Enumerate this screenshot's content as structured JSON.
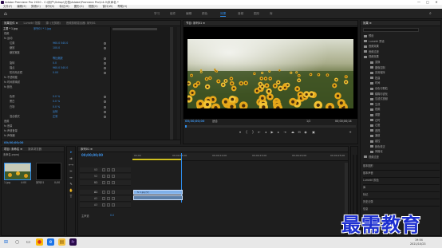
{
  "window": {
    "title": "Adobe Premiere Pro 2020 - C:\\用户\\Gdrop\\文档\\Adobe\\Premiere Pro\\14.0\\未命名 *",
    "minimize": "—",
    "maximize": "□",
    "close": "✕"
  },
  "menu": [
    "文件(F)",
    "编辑(E)",
    "剪辑(C)",
    "序列(S)",
    "标记(M)",
    "图形(G)",
    "视图(V)",
    "窗口(W)",
    "帮助(H)"
  ],
  "workspaces": [
    {
      "label": "学习",
      "active": false
    },
    {
      "label": "组件",
      "active": false
    },
    {
      "label": "编辑",
      "active": false
    },
    {
      "label": "颜色",
      "active": false
    },
    {
      "label": "效果",
      "active": true
    },
    {
      "label": "音频",
      "active": false
    },
    {
      "label": "图形",
      "active": false
    },
    {
      "label": "库",
      "active": false
    }
  ],
  "effect_controls": {
    "tabs": [
      "效果控件 ≡",
      "Lumetri 范围",
      "源: (无剪辑)",
      "音频剪辑混合器: 序列01"
    ],
    "clip_label": "主要 * 1.jpg",
    "sequence_label": "序列01 * 1.jpg",
    "rows": [
      {
        "label": "视频",
        "value": ""
      },
      {
        "label": "fx 运动",
        "value": ""
      },
      {
        "label": "位置",
        "value": "960.0   540.0"
      },
      {
        "label": "缩放",
        "value": "100.0"
      },
      {
        "label": "缩放宽度",
        "value": ""
      },
      {
        "label": "",
        "value": "等比缩放"
      },
      {
        "label": "旋转",
        "value": "0.0"
      },
      {
        "label": "锚点",
        "value": "960.0   540.0"
      },
      {
        "label": "防闪烁滤镜",
        "value": "0.00"
      },
      {
        "label": "fx 不透明度",
        "value": ""
      },
      {
        "label": "fx 时间重映射",
        "value": ""
      },
      {
        "label": "fx 颜色",
        "value": ""
      },
      {
        "label": "",
        "value": ""
      },
      {
        "label": "色调",
        "value": "0.0 %"
      },
      {
        "label": "黑白",
        "value": "0.0 %"
      },
      {
        "label": "白场",
        "value": "0.0 %"
      },
      {
        "label": "",
        "value": "反转"
      },
      {
        "label": "混合模式",
        "value": "正常"
      },
      {
        "label": "音频",
        "value": ""
      },
      {
        "label": "fx 音量",
        "value": ""
      },
      {
        "label": "fx 声道音量",
        "value": ""
      },
      {
        "label": "fx 声像器",
        "value": ""
      }
    ],
    "timecode": "00;00;00;00"
  },
  "program_monitor": {
    "tab": "节目: 序列01 ≡",
    "timecode_left": "00;00;00;00",
    "fit": "适合",
    "quality": "1/2",
    "timecode_right": "00;00;00;14"
  },
  "project": {
    "tabs": [
      "项目: 未命名 ≡",
      "媒体浏览器"
    ],
    "file": "未命名.prproj",
    "items": [
      {
        "name": "1.jpg",
        "info": "4:00"
      },
      {
        "name": "序列01",
        "info": "0;00"
      }
    ]
  },
  "timeline": {
    "tab": "序列01 ≡",
    "timecode": "00;00;00;00",
    "ruler": [
      "00;00",
      "00;00;05;00",
      "00;00;10;00",
      "00;00;15;00",
      "00;00;20;00",
      "00;00;25;00"
    ],
    "tracks": [
      "V3",
      "V2",
      "V1",
      "A1",
      "A2",
      "A3"
    ],
    "master": "主声道",
    "master_value": "0.0",
    "clip_label": "fx 1.jpg [V]"
  },
  "effects": {
    "tab": "效果 ≡",
    "items": [
      "预设",
      "Lumetri 预设",
      "音频效果",
      "音频过渡",
      "视频效果",
      "变换",
      "图像控制",
      "实用程序",
      "扭曲",
      "时间",
      "杂色与颗粒",
      "模糊与锐化",
      "沉浸式视频",
      "生成",
      "视频",
      "调整",
      "过时",
      "过渡",
      "透视",
      "通道",
      "键控",
      "颜色校正",
      "风格化",
      "视频过渡"
    ],
    "selected": "颜色",
    "bottom": [
      "基本图形",
      "基本声音",
      "Lumetri 颜色",
      "库",
      "标记",
      "历史记录",
      "信息"
    ]
  },
  "taskbar": {
    "time": "19:54",
    "date": "2021/10/23"
  },
  "watermark": "最需教育",
  "colors": {
    "accent": "#2d8ceb",
    "timecode": "#3b8de0",
    "clip_video": "#7fb0e8"
  }
}
